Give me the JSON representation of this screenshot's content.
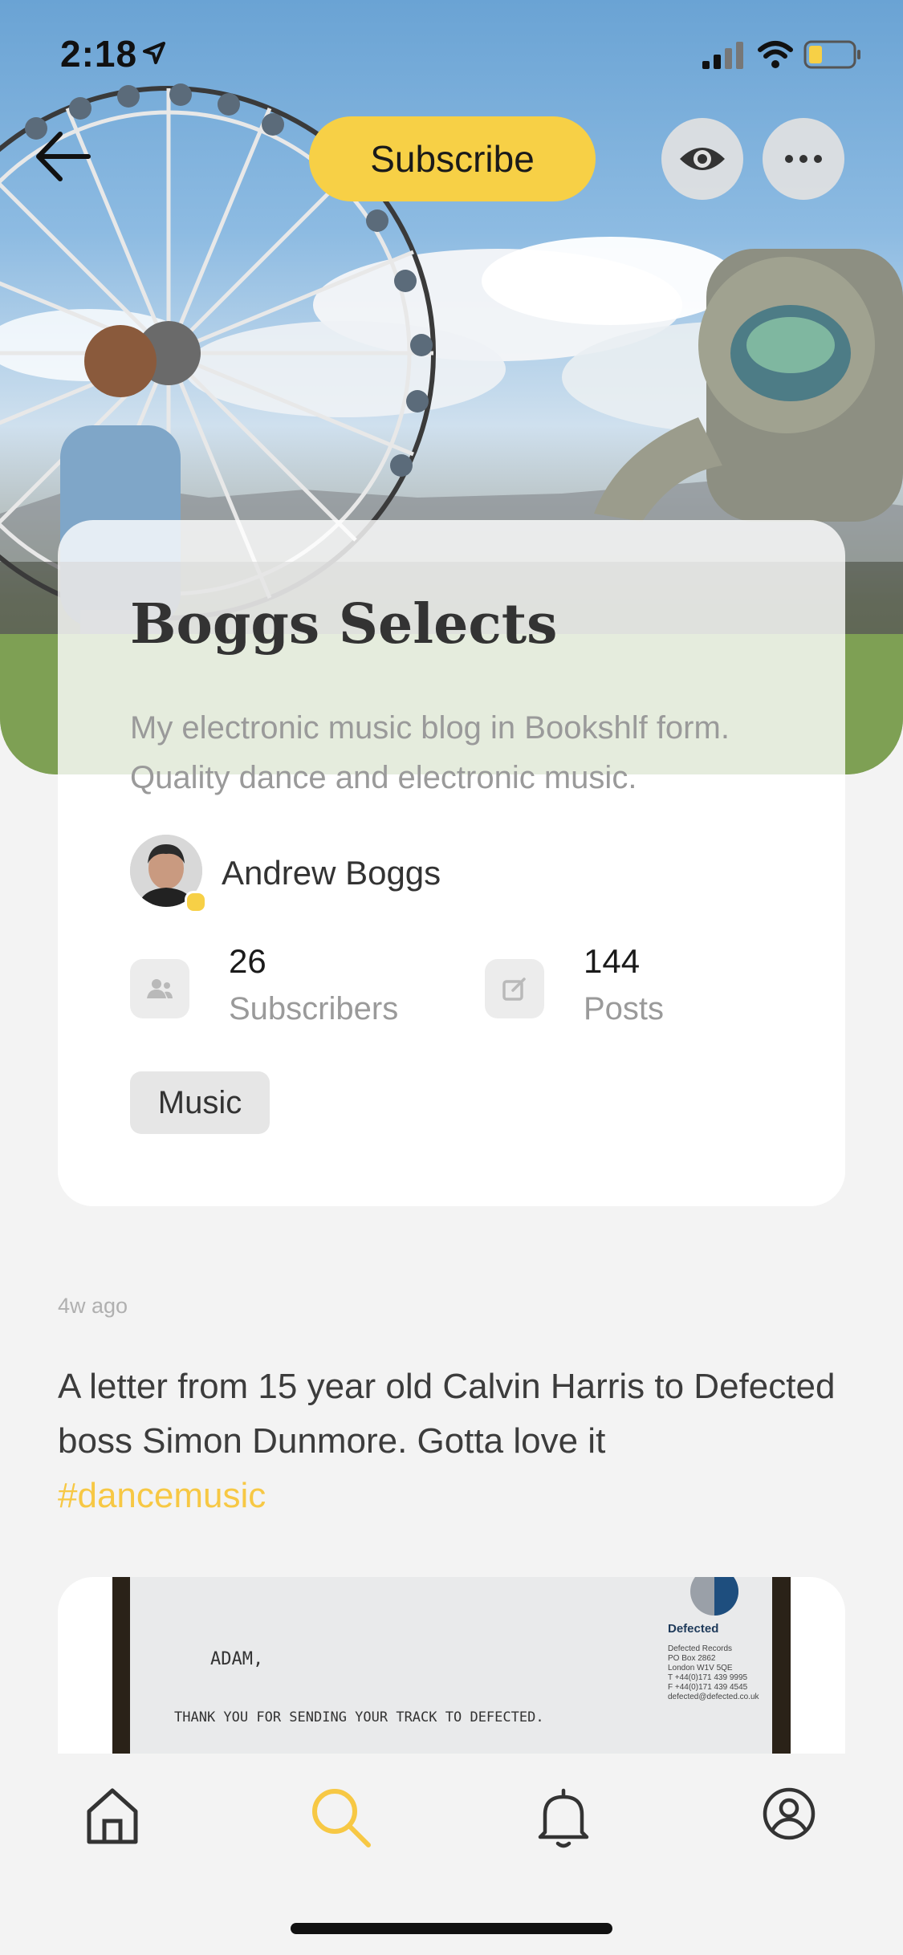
{
  "status_bar": {
    "time": "2:18"
  },
  "header": {
    "subscribe_label": "Subscribe"
  },
  "icons": [
    "arrow-left-icon",
    "eye-icon",
    "more-icon",
    "home-icon",
    "search-icon",
    "bell-icon",
    "profile-icon"
  ],
  "colors": {
    "accent": "#f7d046",
    "background": "#f3f3f3",
    "card": "#ffffff"
  },
  "profile": {
    "title": "Boggs Selects",
    "description": "My electronic music blog in Bookshlf form. Quality dance and electronic music.",
    "author": "Andrew Boggs",
    "subscribers_count": "26",
    "subscribers_label": "Subscribers",
    "posts_count": "144",
    "posts_label": "Posts",
    "tag": "Music"
  },
  "post": {
    "time": "4w ago",
    "text": "A letter from 15 year old Calvin Harris to Defected boss Simon Dunmore. Gotta love it",
    "hashtag": "#dancemusic",
    "letter": {
      "logo_label": "Defected",
      "address": [
        "Defected Records",
        "PO Box 2862",
        "London W1V 5QE",
        "T +44(0)171 439 9995",
        "F +44(0)171 439 4545",
        "defected@defected.co.uk"
      ],
      "salutation": "ADAM,",
      "line1": "THANK YOU FOR SENDING YOUR TRACK TO DEFECTED."
    }
  }
}
